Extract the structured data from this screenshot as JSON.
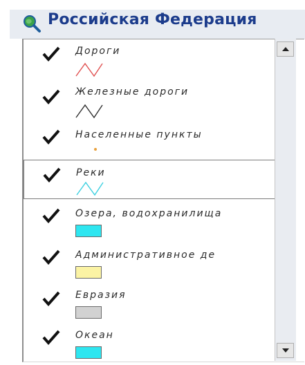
{
  "window": {
    "title": "Российская Федерация",
    "title_icon": "globe-magnifier-icon"
  },
  "layers": [
    {
      "label": "Дороги",
      "checked": true,
      "symbol": "line",
      "color": "#e05050"
    },
    {
      "label": "Железные дороги",
      "checked": true,
      "symbol": "line",
      "color": "#303030"
    },
    {
      "label": "Населенные пункты",
      "checked": true,
      "symbol": "point",
      "color": "#e8a03c"
    },
    {
      "label": "Реки",
      "checked": true,
      "symbol": "line",
      "color": "#3cd0e0",
      "selected": true
    },
    {
      "label": "Озера, водохранилища",
      "checked": true,
      "symbol": "fill",
      "color": "#2ee6f0"
    },
    {
      "label": "Административное де",
      "checked": true,
      "symbol": "fill",
      "color": "#fbf3a4"
    },
    {
      "label": "Евразия",
      "checked": true,
      "symbol": "fill",
      "color": "#d2d2d2"
    },
    {
      "label": "Океан",
      "checked": true,
      "symbol": "fill",
      "color": "#2ee6f0"
    }
  ],
  "scrollbar": {
    "up_icon": "arrow-up-icon",
    "down_icon": "arrow-down-icon"
  }
}
